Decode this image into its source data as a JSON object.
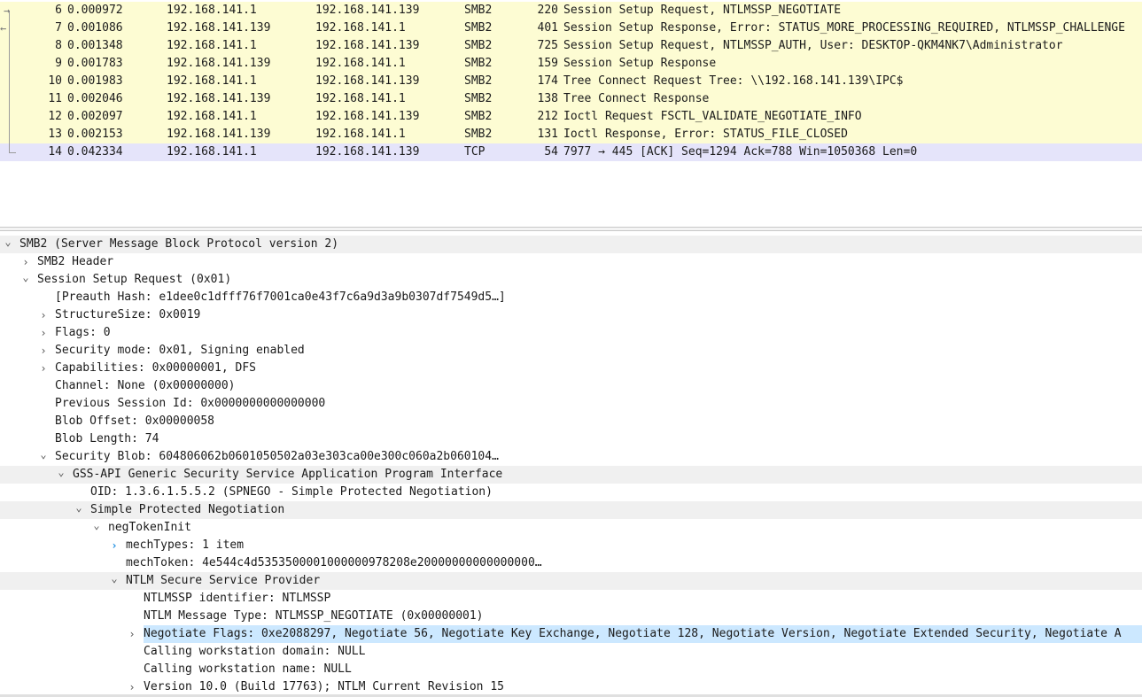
{
  "colors": {
    "yellow_row": "#fdfcd3",
    "lavender_row": "#e5e4fa",
    "selected_node": "#cce8ff",
    "expand_blue": "#1a8ce0"
  },
  "packets": [
    {
      "no": "6",
      "time": "0.000972",
      "src": "192.168.141.1",
      "dst": "192.168.141.139",
      "proto": "SMB2",
      "len": "220",
      "info": "Session Setup Request, NTLMSSP_NEGOTIATE",
      "rel": "request"
    },
    {
      "no": "7",
      "time": "0.001086",
      "src": "192.168.141.139",
      "dst": "192.168.141.1",
      "proto": "SMB2",
      "len": "401",
      "info": "Session Setup Response, Error: STATUS_MORE_PROCESSING_REQUIRED, NTLMSSP_CHALLENGE",
      "rel": "response"
    },
    {
      "no": "8",
      "time": "0.001348",
      "src": "192.168.141.1",
      "dst": "192.168.141.139",
      "proto": "SMB2",
      "len": "725",
      "info": "Session Setup Request, NTLMSSP_AUTH, User: DESKTOP-QKM4NK7\\Administrator",
      "rel": "line"
    },
    {
      "no": "9",
      "time": "0.001783",
      "src": "192.168.141.139",
      "dst": "192.168.141.1",
      "proto": "SMB2",
      "len": "159",
      "info": "Session Setup Response",
      "rel": "line"
    },
    {
      "no": "10",
      "time": "0.001983",
      "src": "192.168.141.1",
      "dst": "192.168.141.139",
      "proto": "SMB2",
      "len": "174",
      "info": "Tree Connect Request Tree: \\\\192.168.141.139\\IPC$",
      "rel": "line"
    },
    {
      "no": "11",
      "time": "0.002046",
      "src": "192.168.141.139",
      "dst": "192.168.141.1",
      "proto": "SMB2",
      "len": "138",
      "info": "Tree Connect Response",
      "rel": "line"
    },
    {
      "no": "12",
      "time": "0.002097",
      "src": "192.168.141.1",
      "dst": "192.168.141.139",
      "proto": "SMB2",
      "len": "212",
      "info": "Ioctl Request FSCTL_VALIDATE_NEGOTIATE_INFO",
      "rel": "line"
    },
    {
      "no": "13",
      "time": "0.002153",
      "src": "192.168.141.139",
      "dst": "192.168.141.1",
      "proto": "SMB2",
      "len": "131",
      "info": "Ioctl Response, Error: STATUS_FILE_CLOSED",
      "rel": "line"
    },
    {
      "no": "14",
      "time": "0.042334",
      "src": "192.168.141.1",
      "dst": "192.168.141.139",
      "proto": "TCP",
      "len": "54",
      "info": "7977 → 445 [ACK] Seq=1294 Ack=788 Win=1050368 Len=0",
      "rel": "end"
    }
  ],
  "tree": [
    {
      "depth": 0,
      "arrow": "expanded",
      "text": "SMB2 (Server Message Block Protocol version 2)",
      "hl": true
    },
    {
      "depth": 1,
      "arrow": "collapsed",
      "text": "SMB2 Header"
    },
    {
      "depth": 1,
      "arrow": "expanded",
      "text": "Session Setup Request (0x01)"
    },
    {
      "depth": 2,
      "arrow": "none",
      "text": "[Preauth Hash: e1dee0c1dfff76f7001ca0e43f7c6a9d3a9b0307df7549d5…]"
    },
    {
      "depth": 2,
      "arrow": "collapsed",
      "text": "StructureSize: 0x0019"
    },
    {
      "depth": 2,
      "arrow": "collapsed",
      "text": "Flags: 0"
    },
    {
      "depth": 2,
      "arrow": "collapsed",
      "text": "Security mode: 0x01, Signing enabled"
    },
    {
      "depth": 2,
      "arrow": "collapsed",
      "text": "Capabilities: 0x00000001, DFS"
    },
    {
      "depth": 2,
      "arrow": "none",
      "text": "Channel: None (0x00000000)"
    },
    {
      "depth": 2,
      "arrow": "none",
      "text": "Previous Session Id: 0x0000000000000000"
    },
    {
      "depth": 2,
      "arrow": "none",
      "text": "Blob Offset: 0x00000058"
    },
    {
      "depth": 2,
      "arrow": "none",
      "text": "Blob Length: 74"
    },
    {
      "depth": 2,
      "arrow": "expanded",
      "text": "Security Blob: 604806062b0601050502a03e303ca00e300c060a2b060104…"
    },
    {
      "depth": 3,
      "arrow": "expanded",
      "text": "GSS-API Generic Security Service Application Program Interface",
      "hl": true
    },
    {
      "depth": 4,
      "arrow": "none",
      "text": "OID: 1.3.6.1.5.5.2 (SPNEGO - Simple Protected Negotiation)"
    },
    {
      "depth": 4,
      "arrow": "expanded",
      "text": "Simple Protected Negotiation",
      "hl": true
    },
    {
      "depth": 5,
      "arrow": "expanded",
      "text": "negTokenInit"
    },
    {
      "depth": 6,
      "arrow": "collapsed-blue",
      "text": "mechTypes: 1 item"
    },
    {
      "depth": 6,
      "arrow": "none",
      "text": "mechToken: 4e544c4d535350000100000097820 8e20000000000000000…"
    },
    {
      "depth": 6,
      "arrow": "expanded",
      "text": "NTLM Secure Service Provider",
      "hl": true
    },
    {
      "depth": 7,
      "arrow": "none",
      "text": "NTLMSSP identifier: NTLMSSP"
    },
    {
      "depth": 7,
      "arrow": "none",
      "text": "NTLM Message Type: NTLMSSP_NEGOTIATE (0x00000001)"
    },
    {
      "depth": 7,
      "arrow": "collapsed",
      "text": "Negotiate Flags: 0xe2088297, Negotiate 56, Negotiate Key Exchange, Negotiate 128, Negotiate Version, Negotiate Extended Security, Negotiate A",
      "sel": true
    },
    {
      "depth": 7,
      "arrow": "none",
      "text": "Calling workstation domain: NULL"
    },
    {
      "depth": 7,
      "arrow": "none",
      "text": "Calling workstation name: NULL"
    },
    {
      "depth": 7,
      "arrow": "collapsed",
      "text": "Version 10.0 (Build 17763); NTLM Current Revision 15"
    }
  ]
}
